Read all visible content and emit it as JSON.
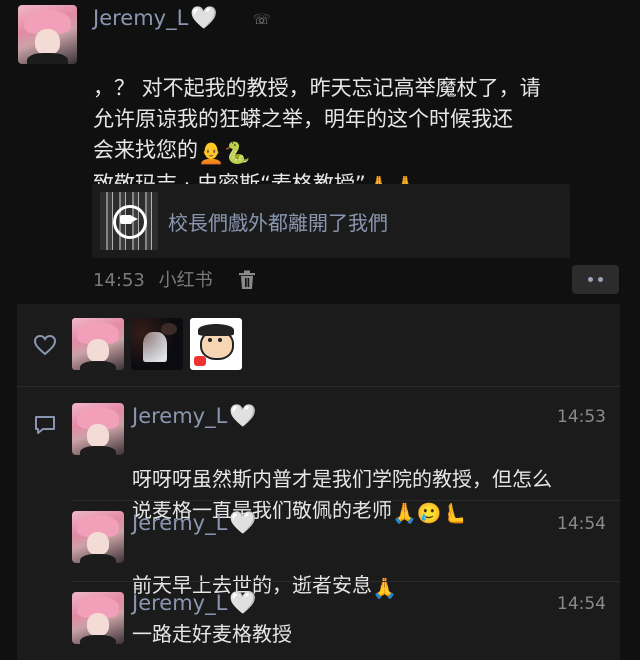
{
  "post": {
    "author": "Jeremy_L",
    "author_heart": "🤍",
    "text_line1": "，？ 对不起我的教授，昨天忘记高举魔杖了，请",
    "text_line2": "允许原谅我的狂蟒之举，明年的这个时候我还",
    "text_line3": "会来找您的",
    "text_line3_emoji": "🧑‍🦲🐍",
    "text_line4": "致敬玛吉 · 史密斯“麦格教授”",
    "text_line4_emoji": "🙏🙏",
    "link_title": "校長們戲外都離開了我們",
    "time": "14:53",
    "source": "小红书",
    "icons": {
      "delete": "trash-icon",
      "more": "more-dots-icon",
      "video": "video-camera-icon"
    }
  },
  "likes": {
    "icon": "heart-outline-icon",
    "avatars": [
      "avatar-pink-hair",
      "avatar-dark-figure",
      "avatar-cartoon-crayon"
    ]
  },
  "comments_icon": "comment-bubble-icon",
  "comments": [
    {
      "author": "Jeremy_L",
      "heart": "🤍",
      "time": "14:53",
      "line1": "呀呀呀虽然斯内普才是我们学院的教授，但怎么",
      "line2": "说麦格一直是我们敬佩的老师",
      "line2_emoji": "🙏🥲🫷"
    },
    {
      "author": "Jeremy_L",
      "heart": "🤍",
      "time": "14:54",
      "line1": "前天早上去世的，逝者安息",
      "line1_emoji": "🙏"
    },
    {
      "author": "Jeremy_L",
      "heart": "🤍",
      "time": "14:54",
      "line1": "一路走好麦格教授"
    }
  ],
  "colors": {
    "background": "#101010",
    "panel": "#1b1b1b",
    "name": "#8a96b0",
    "text": "#e6e6e6"
  }
}
